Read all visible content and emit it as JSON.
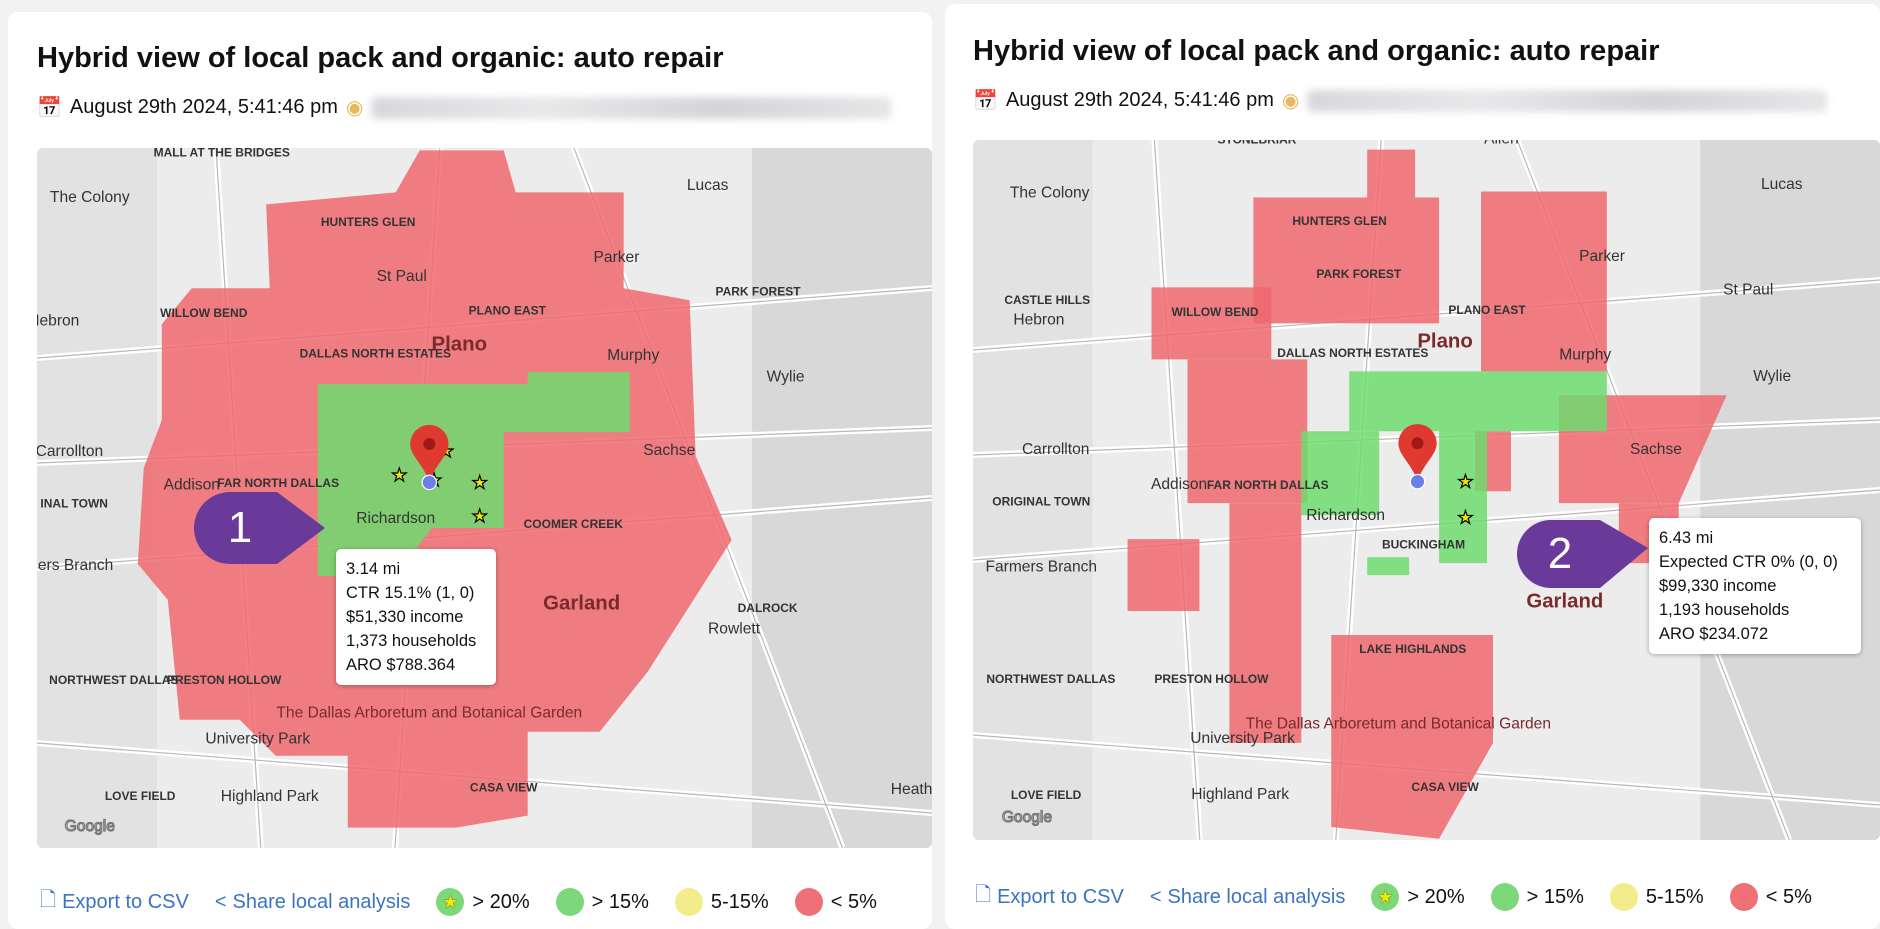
{
  "panels": [
    {
      "title": "Hybrid view of local pack and organic: auto repair",
      "date": "August 29th 2024, 5:41:46 pm",
      "callout": "1",
      "tooltip": [
        "3.14 mi",
        "CTR 15.1% (1, 0)",
        "$51,330 income",
        "1,373 households",
        "ARO $788.364"
      ],
      "labels": [
        "MALL AT THE BRIDGES",
        "The Colony",
        "Lucas",
        "HUNTERS GLEN",
        "Parker",
        "PARK FOREST",
        "St Paul",
        "WILLOW BEND",
        "PLANO EAST",
        "Hebron",
        "Plano",
        "DALLAS NORTH ESTATES",
        "Murphy",
        "Wylie",
        "Carrollton",
        "Sachse",
        "Addison",
        "FAR NORTH DALLAS",
        "Richardson",
        "INAL TOWN",
        "COOMER CREEK",
        "Farmers Branch",
        "Garland",
        "DALROCK",
        "Rowlett",
        "NORTHWEST DALLAS",
        "PRESTON HOLLOW",
        "The Dallas Arboretum and Botanical Garden",
        "University Park",
        "LOVE FIELD",
        "Highland Park",
        "CASA VIEW",
        "Heath",
        "Google"
      ]
    },
    {
      "title": "Hybrid view of local pack and organic: auto repair",
      "date": "August 29th 2024, 5:41:46 pm",
      "callout": "2",
      "tooltip": [
        "6.43 mi",
        "Expected CTR 0% (0, 0)",
        "$99,330 income",
        "1,193 households",
        "ARO $234.072"
      ],
      "labels": [
        "Allen",
        "STONEBRIAR",
        "The Colony",
        "Lucas",
        "HUNTERS GLEN",
        "Parker",
        "CASTLE HILLS",
        "PARK FOREST",
        "St Paul",
        "Hebron",
        "WILLOW BEND",
        "PLANO EAST",
        "Plano",
        "DALLAS NORTH ESTATES",
        "Murphy",
        "Wylie",
        "Carrollton",
        "Sachse",
        "Addison",
        "FAR NORTH DALLAS",
        "ORIGINAL TOWN",
        "Richardson",
        "BUCKINGHAM",
        "Farmers Branch",
        "Garland",
        "LAKE HIGHLANDS",
        "NORTHWEST DALLAS",
        "PRESTON HOLLOW",
        "The Dallas Arboretum and Botanical Garden",
        "University Park",
        "LOVE FIELD",
        "Highland Park",
        "CASA VIEW",
        "Google"
      ]
    }
  ],
  "footer": {
    "export": "Export to CSV",
    "share": "Share local analysis",
    "legend": [
      {
        "label": "> 20%",
        "color": "#7dd87a",
        "icon": "star-icon"
      },
      {
        "label": "> 15%",
        "color": "#7dd87a"
      },
      {
        "label": "5-15%",
        "color": "#f2ec8a"
      },
      {
        "label": "< 5%",
        "color": "#f07078"
      }
    ]
  },
  "colors": {
    "red": "#f0686e",
    "green": "#6fdc6f",
    "callout": "#6a3a9a",
    "link": "#3b73c4"
  }
}
